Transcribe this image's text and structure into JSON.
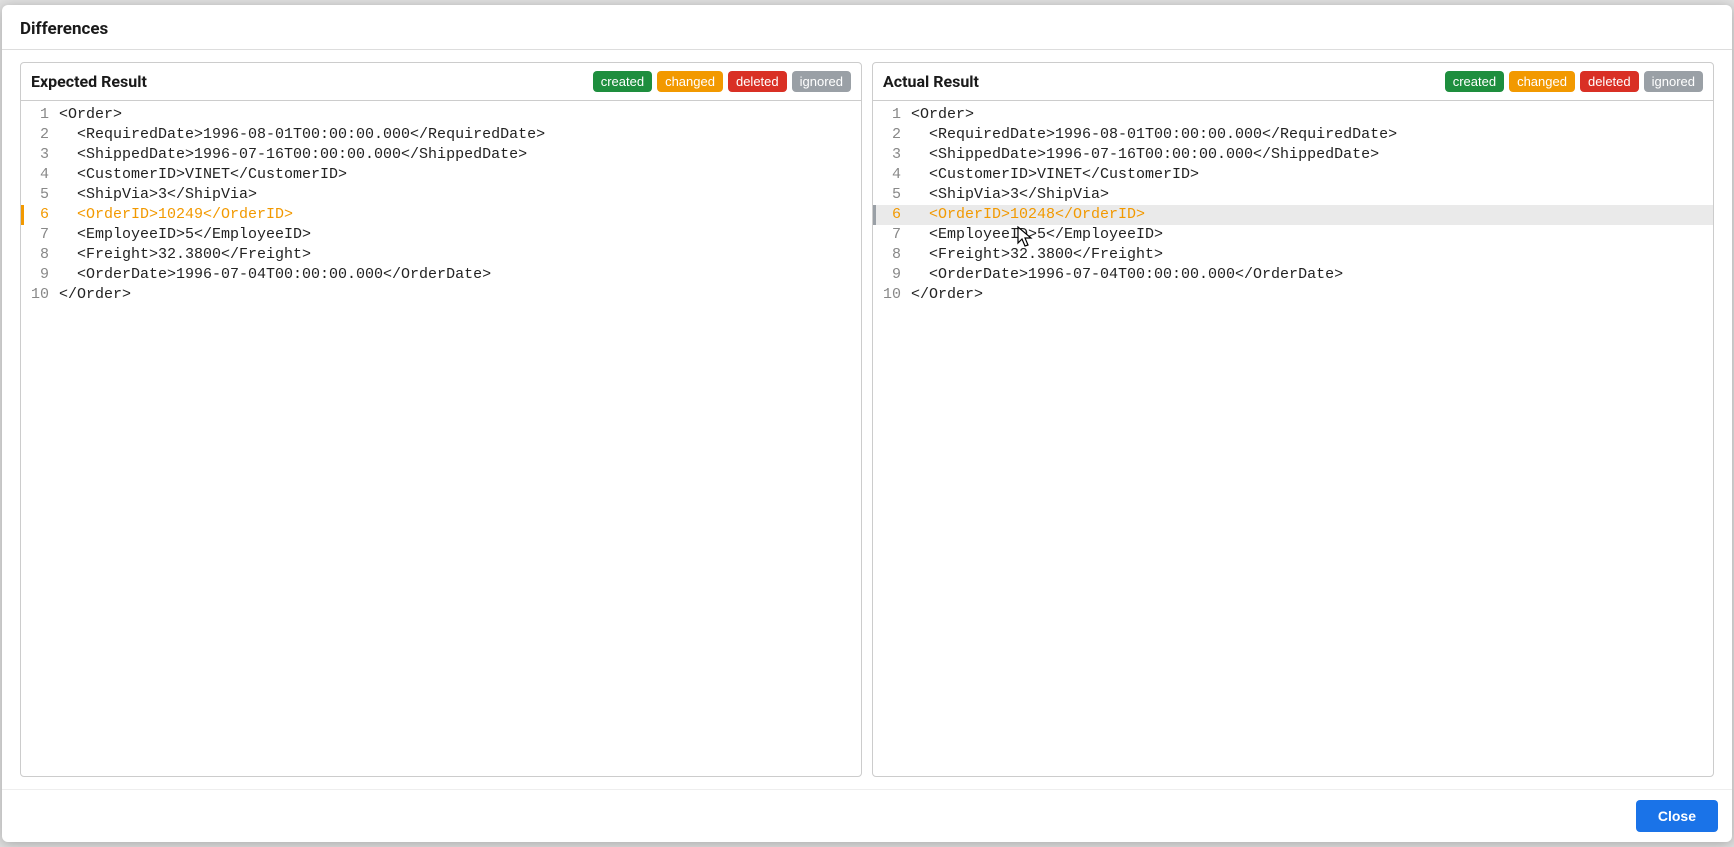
{
  "dialog": {
    "title": "Differences",
    "close_label": "Close"
  },
  "badges": {
    "created": "created",
    "changed": "changed",
    "deleted": "deleted",
    "ignored": "ignored"
  },
  "expected": {
    "title": "Expected Result",
    "lines": [
      {
        "n": 1,
        "t": "<Order>",
        "state": ""
      },
      {
        "n": 2,
        "t": "  <RequiredDate>1996-08-01T00:00:00.000</RequiredDate>",
        "state": ""
      },
      {
        "n": 3,
        "t": "  <ShippedDate>1996-07-16T00:00:00.000</ShippedDate>",
        "state": ""
      },
      {
        "n": 4,
        "t": "  <CustomerID>VINET</CustomerID>",
        "state": ""
      },
      {
        "n": 5,
        "t": "  <ShipVia>3</ShipVia>",
        "state": ""
      },
      {
        "n": 6,
        "t": "  <OrderID>10249</OrderID>",
        "state": "changed"
      },
      {
        "n": 7,
        "t": "  <EmployeeID>5</EmployeeID>",
        "state": ""
      },
      {
        "n": 8,
        "t": "  <Freight>32.3800</Freight>",
        "state": ""
      },
      {
        "n": 9,
        "t": "  <OrderDate>1996-07-04T00:00:00.000</OrderDate>",
        "state": ""
      },
      {
        "n": 10,
        "t": "</Order>",
        "state": ""
      }
    ]
  },
  "actual": {
    "title": "Actual Result",
    "lines": [
      {
        "n": 1,
        "t": "<Order>",
        "state": ""
      },
      {
        "n": 2,
        "t": "  <RequiredDate>1996-08-01T00:00:00.000</RequiredDate>",
        "state": ""
      },
      {
        "n": 3,
        "t": "  <ShippedDate>1996-07-16T00:00:00.000</ShippedDate>",
        "state": ""
      },
      {
        "n": 4,
        "t": "  <CustomerID>VINET</CustomerID>",
        "state": ""
      },
      {
        "n": 5,
        "t": "  <ShipVia>3</ShipVia>",
        "state": ""
      },
      {
        "n": 6,
        "t": "  <OrderID>10248</OrderID>",
        "state": "changed"
      },
      {
        "n": 7,
        "t": "  <EmployeeID>5</EmployeeID>",
        "state": ""
      },
      {
        "n": 8,
        "t": "  <Freight>32.3800</Freight>",
        "state": ""
      },
      {
        "n": 9,
        "t": "  <OrderDate>1996-07-04T00:00:00.000</OrderDate>",
        "state": ""
      },
      {
        "n": 10,
        "t": "</Order>",
        "state": ""
      }
    ]
  }
}
